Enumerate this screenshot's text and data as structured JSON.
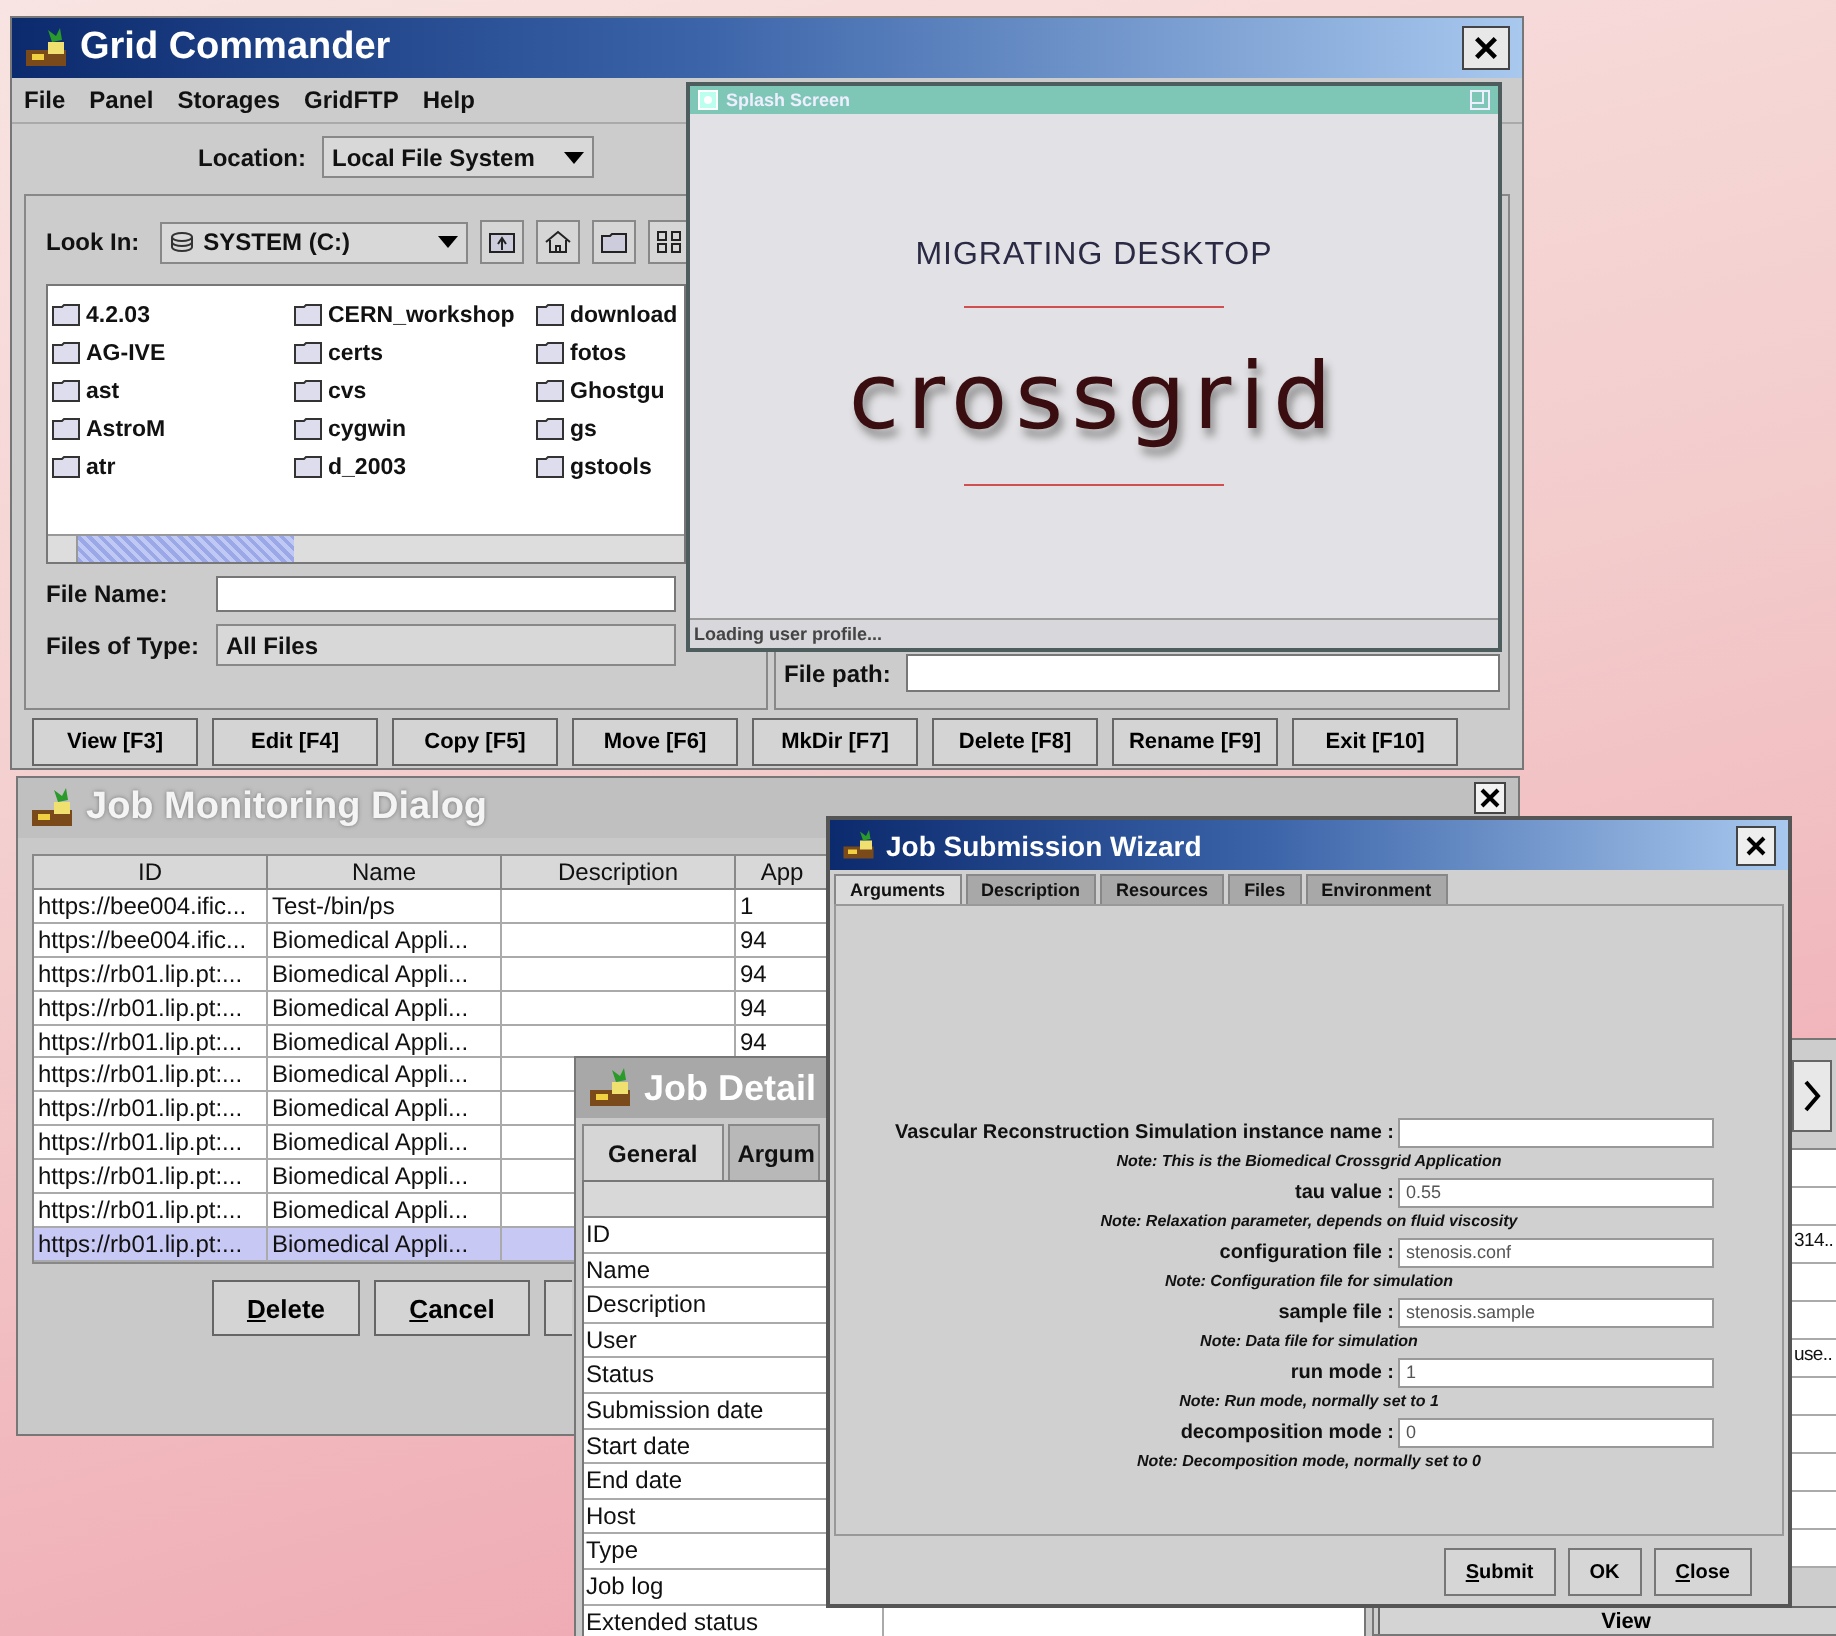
{
  "grid_commander": {
    "title": "Grid Commander",
    "menu": [
      "File",
      "Panel",
      "Storages",
      "GridFTP",
      "Help"
    ],
    "location": {
      "label": "Location:",
      "value": "Local File System"
    },
    "look_in": {
      "label": "Look In:",
      "value": "SYSTEM (C:)"
    },
    "files": [
      "4.2.03",
      "AG-IVE",
      "ast",
      "AstroM",
      "atr",
      "CERN_workshop",
      "certs",
      "cvs",
      "cygwin",
      "d_2003",
      "download",
      "fotos",
      "Ghostgu",
      "gs",
      "gstools"
    ],
    "file_name": {
      "label": "File Name:"
    },
    "files_of_type": {
      "label": "Files of Type:",
      "value": "All Files"
    },
    "file_path": {
      "label": "File path:"
    },
    "buttons": [
      "View [F3]",
      "Edit [F4]",
      "Copy [F5]",
      "Move [F6]",
      "MkDir [F7]",
      "Delete [F8]",
      "Rename [F9]",
      "Exit [F10]"
    ]
  },
  "splash": {
    "title": "Splash Screen",
    "heading": "MIGRATING DESKTOP",
    "logo": "crossgrid",
    "status": "Loading user profile..."
  },
  "job_monitoring": {
    "title": "Job Monitoring Dialog",
    "columns": [
      "ID",
      "Name",
      "Description",
      "App"
    ],
    "rows": [
      {
        "id": "https://bee004.ific...",
        "name": "Test-/bin/ps",
        "app": "1",
        "selected": false
      },
      {
        "id": "https://bee004.ific...",
        "name": "Biomedical Appli...",
        "app": "94",
        "selected": false
      },
      {
        "id": "https://rb01.lip.pt:...",
        "name": "Biomedical Appli...",
        "app": "94",
        "selected": false
      },
      {
        "id": "https://rb01.lip.pt:...",
        "name": "Biomedical Appli...",
        "app": "94",
        "selected": false
      },
      {
        "id": "https://rb01.lip.pt:...",
        "name": "Biomedical Appli...",
        "app": "94",
        "selected": false
      },
      {
        "id": "https://rb01.lip.pt:...",
        "name": "Biomedical Appli...",
        "selected": false
      },
      {
        "id": "https://rb01.lip.pt:...",
        "name": "Biomedical Appli...",
        "selected": false
      },
      {
        "id": "https://rb01.lip.pt:...",
        "name": "Biomedical Appli...",
        "selected": false
      },
      {
        "id": "https://rb01.lip.pt:...",
        "name": "Biomedical Appli...",
        "selected": false
      },
      {
        "id": "https://rb01.lip.pt:...",
        "name": "Biomedical Appli...",
        "selected": false
      },
      {
        "id": "https://rb01.lip.pt:...",
        "name": "Biomedical Appli...",
        "selected": true
      }
    ],
    "buttons": [
      "Delete",
      "Cancel"
    ]
  },
  "job_details": {
    "title": "Job Detail",
    "tabs": [
      {
        "label": "General",
        "selected": true
      },
      {
        "label": "Argum",
        "selected": false
      }
    ],
    "fields": [
      "ID",
      "Name",
      "Description",
      "User",
      "Status",
      "Submission date",
      "Start date",
      "End date",
      "Host",
      "Type",
      "Job log",
      "Extended status"
    ]
  },
  "background_window": {
    "cells": [
      "314..",
      "use.."
    ],
    "button": "View"
  },
  "job_wizard": {
    "title": "Job Submission Wizard",
    "tabs": [
      {
        "label": "Arguments",
        "selected": true
      },
      {
        "label": "Description",
        "selected": false
      },
      {
        "label": "Resources",
        "selected": false
      },
      {
        "label": "Files",
        "selected": false
      },
      {
        "label": "Environment",
        "selected": false
      }
    ],
    "fields": [
      {
        "label": "Vascular Reconstruction Simulation instance name :",
        "note": "Note: This is the Biomedical Crossgrid Application"
      },
      {
        "label": "tau value :",
        "value": "0.55",
        "note": "Note: Relaxation parameter, depends on fluid viscosity"
      },
      {
        "label": "configuration file :",
        "value": "stenosis.conf",
        "note": "Note: Configuration file for simulation"
      },
      {
        "label": "sample file :",
        "value": "stenosis.sample",
        "note": "Note: Data file for simulation"
      },
      {
        "label": "run mode :",
        "value": "1",
        "note": "Note: Run mode, normally set to 1"
      },
      {
        "label": "decomposition mode :",
        "value": "0",
        "note": "Note: Decomposition mode, normally set to 0"
      }
    ],
    "buttons": [
      "Submit",
      "OK",
      "Close"
    ]
  }
}
